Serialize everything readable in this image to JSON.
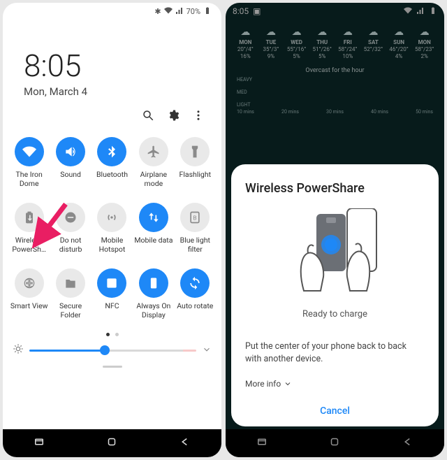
{
  "left": {
    "status": {
      "battery": "70%"
    },
    "clock": {
      "time": "8:05",
      "date": "Mon, March 4"
    },
    "tiles": [
      {
        "id": "wifi",
        "label": "The Iron Dome",
        "on": true
      },
      {
        "id": "sound",
        "label": "Sound",
        "on": true
      },
      {
        "id": "bluetooth",
        "label": "Bluetooth",
        "on": true
      },
      {
        "id": "airplane",
        "label": "Airplane mode",
        "on": false
      },
      {
        "id": "flashlight",
        "label": "Flashlight",
        "on": false
      },
      {
        "id": "powershare",
        "label": "Wireless PowerSh…",
        "on": false
      },
      {
        "id": "dnd",
        "label": "Do not disturb",
        "on": false
      },
      {
        "id": "hotspot",
        "label": "Mobile Hotspot",
        "on": false
      },
      {
        "id": "mobiledata",
        "label": "Mobile data",
        "on": true
      },
      {
        "id": "bluelight",
        "label": "Blue light filter",
        "on": false
      },
      {
        "id": "smartview",
        "label": "Smart View",
        "on": false
      },
      {
        "id": "securefolder",
        "label": "Secure Folder",
        "on": false
      },
      {
        "id": "nfc",
        "label": "NFC",
        "on": true
      },
      {
        "id": "aod",
        "label": "Always On Display",
        "on": true
      },
      {
        "id": "autorotate",
        "label": "Auto rotate",
        "on": true
      }
    ],
    "pager": {
      "current": 0,
      "total": 2
    },
    "brightness": 45
  },
  "right": {
    "status": {
      "time": "8:05"
    },
    "forecast": {
      "days": [
        {
          "day": "MON",
          "hi": "20°/4°",
          "pct": "16%"
        },
        {
          "day": "TUE",
          "hi": "35°/3°",
          "pct": "9%"
        },
        {
          "day": "WED",
          "hi": "55°/16°",
          "pct": "5%"
        },
        {
          "day": "THU",
          "hi": "51°/26°",
          "pct": "5%"
        },
        {
          "day": "FRI",
          "hi": "58°/24°",
          "pct": "10%"
        },
        {
          "day": "SAT",
          "hi": "52°/32°",
          "pct": ""
        },
        {
          "day": "SUN",
          "hi": "46°/20°",
          "pct": "4%"
        },
        {
          "day": "MON",
          "hi": "58°/23°",
          "pct": "2%"
        }
      ],
      "overcast": "Overcast for the hour",
      "levels": [
        "HEAVY",
        "MED",
        "LIGHT"
      ],
      "timeline": [
        "10 mins",
        "20 mins",
        "30 mins",
        "40 mins",
        "50 mins"
      ]
    },
    "sheet": {
      "title": "Wireless PowerShare",
      "ready": "Ready to charge",
      "instruction": "Put the center of your phone back to back with another device.",
      "more": "More info",
      "cancel": "Cancel"
    }
  }
}
